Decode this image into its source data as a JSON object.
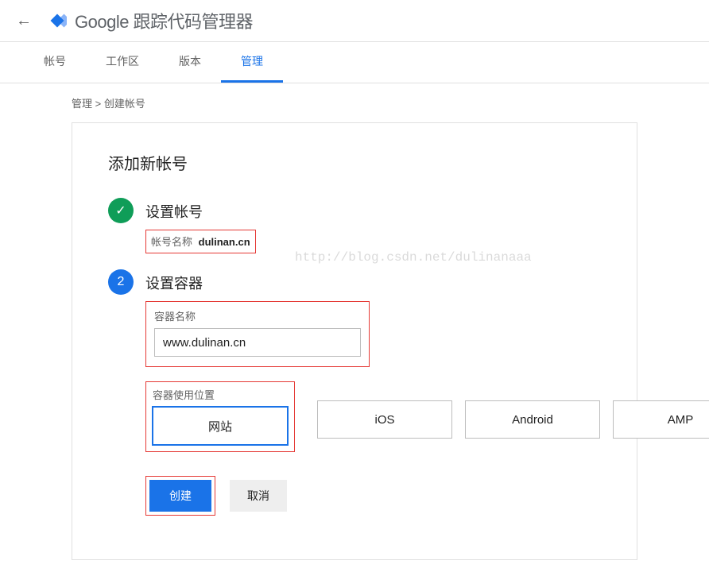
{
  "header": {
    "product": "Google 跟踪代码管理器"
  },
  "tabs": [
    {
      "label": "帐号",
      "active": false
    },
    {
      "label": "工作区",
      "active": false
    },
    {
      "label": "版本",
      "active": false
    },
    {
      "label": "管理",
      "active": true
    }
  ],
  "breadcrumb": "管理 > 创建帐号",
  "page": {
    "title": "添加新帐号",
    "step1": {
      "title": "设置帐号",
      "summary_label": "帐号名称",
      "summary_value": "dulinan.cn"
    },
    "step2": {
      "title": "设置容器",
      "container_name_label": "容器名称",
      "container_name_value": "www.dulinan.cn",
      "usage_label": "容器使用位置",
      "options": [
        "网站",
        "iOS",
        "Android",
        "AMP"
      ]
    },
    "actions": {
      "create": "创建",
      "cancel": "取消"
    }
  },
  "watermark": "http://blog.csdn.net/dulinanaaa"
}
